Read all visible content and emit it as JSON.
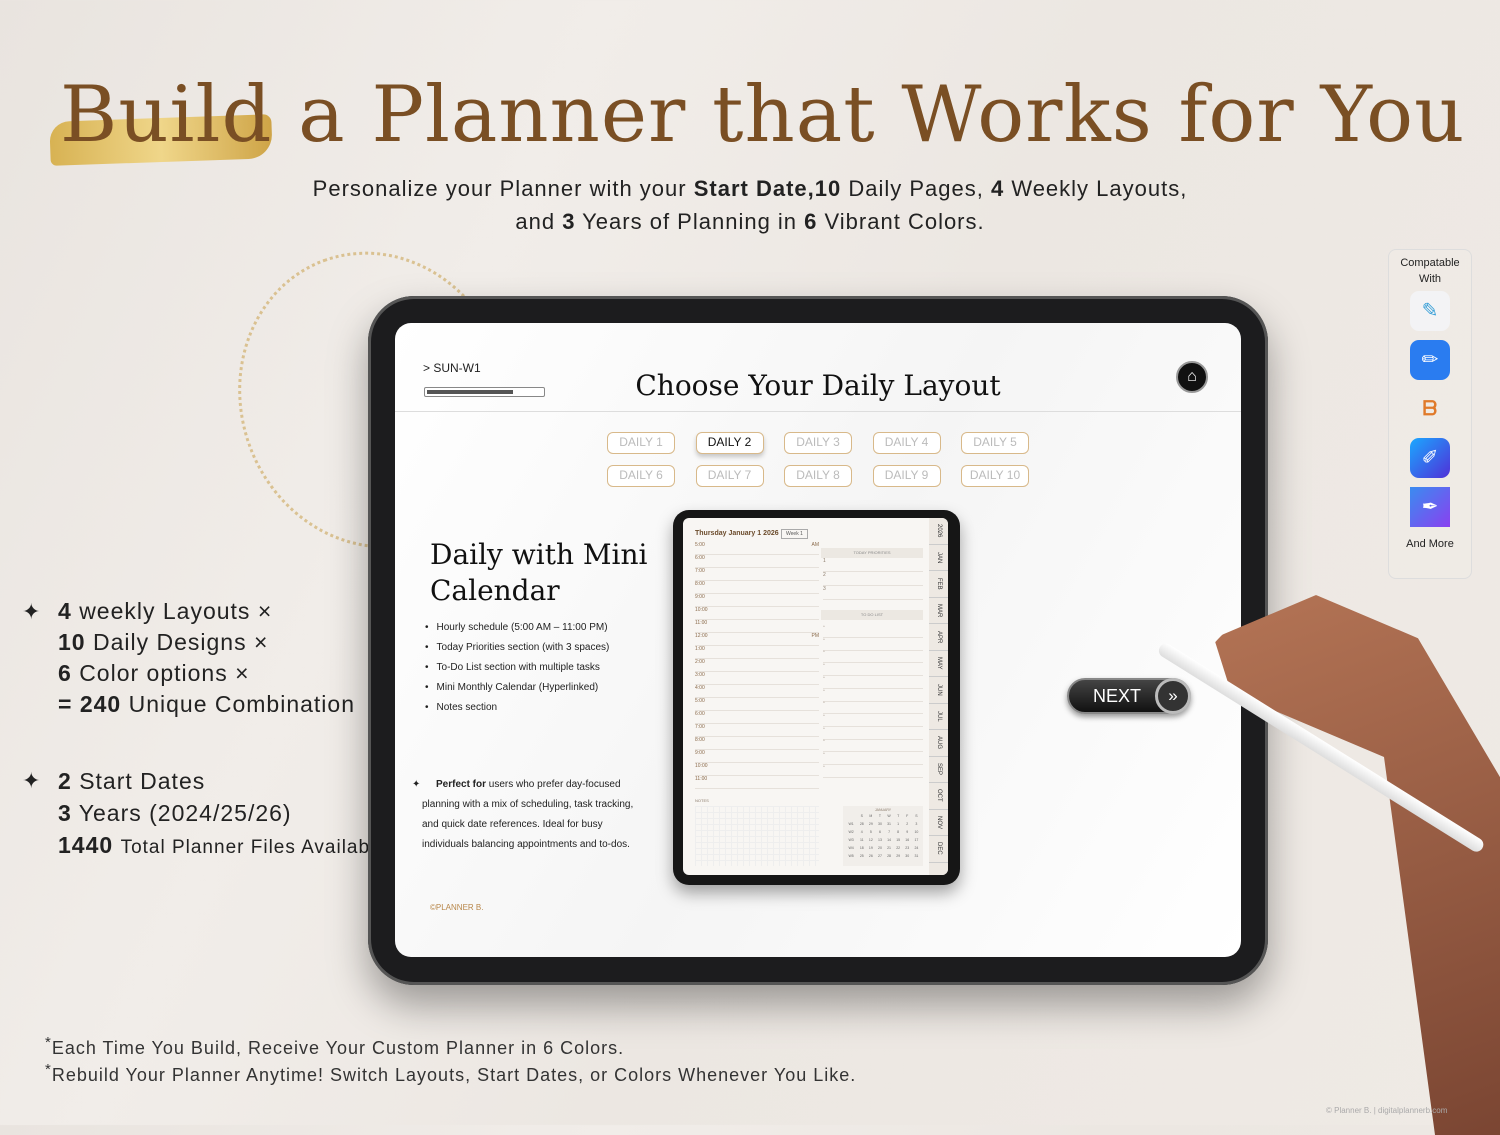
{
  "headline": {
    "title": "Build a Planner that Works for You",
    "sub_line1": [
      "Personalize your Planner with your ",
      "Start Date,10",
      " Daily Pages, ",
      "4",
      " Weekly Layouts,"
    ],
    "sub_line2": [
      "and ",
      "3",
      " Years of Planning in ",
      "6",
      " Vibrant Colors."
    ]
  },
  "features": {
    "combo": [
      {
        "num": "4",
        "text": "weekly Layouts",
        "op": "×"
      },
      {
        "num": "10",
        "text": "Daily Designs",
        "op": "×"
      },
      {
        "num": "6",
        "text": "Color options",
        "op": "×"
      },
      {
        "num": "= 240",
        "text": "Unique Combination",
        "op": ""
      }
    ],
    "files": [
      {
        "num": "2",
        "text": "Start Dates"
      },
      {
        "num": "3",
        "text": "Years (2024/25/26)"
      },
      {
        "num": "1440",
        "text": "Total Planner Files Available"
      }
    ]
  },
  "screen": {
    "breadcrumb": "> SUN-W1",
    "progress": 0.75,
    "title": "Choose Your Daily Layout",
    "layouts": [
      "DAILY 1",
      "DAILY 2",
      "DAILY 3",
      "DAILY 4",
      "DAILY 5",
      "DAILY 6",
      "DAILY 7",
      "DAILY 8",
      "DAILY 9",
      "DAILY 10"
    ],
    "selected_layout": "DAILY 2",
    "layout_name": "Daily with Mini Calendar",
    "bullets": [
      "Hourly schedule (5:00 AM – 11:00 PM)",
      "Today Priorities section (with 3 spaces)",
      "To-Do List section with multiple tasks",
      "Mini Monthly Calendar (Hyperlinked)",
      "Notes section"
    ],
    "perfect_bold": "Perfect for",
    "perfect_text": " users who prefer day-focused planning with a mix of scheduling, task tracking, and quick date references. Ideal for busy individuals balancing appointments and to-dos.",
    "copyright": "©PLANNER B.",
    "next": "NEXT"
  },
  "preview": {
    "date": "Thursday January 1 2026",
    "week": "Week 1",
    "hours": [
      "5:00",
      "6:00",
      "7:00",
      "8:00",
      "9:00",
      "10:00",
      "11:00",
      "12:00",
      "1:00",
      "2:00",
      "3:00",
      "4:00",
      "5:00",
      "6:00",
      "7:00",
      "8:00",
      "9:00",
      "10:00",
      "11:00"
    ],
    "am": "AM",
    "pm": "PM",
    "priorities_label": "TODAY PRIORITIES",
    "priorities": [
      "1",
      "2",
      "3"
    ],
    "todo_label": "TO DO LIST",
    "notes": "NOTES",
    "tabs": [
      "2026",
      "JAN",
      "FEB",
      "MAR",
      "APR",
      "MAY",
      "JUN",
      "JUL",
      "AUG",
      "SEP",
      "OCT",
      "NOV",
      "DEC"
    ],
    "calendar": {
      "month": "JANUARY",
      "days": [
        "S",
        "M",
        "T",
        "W",
        "T",
        "F",
        "S"
      ],
      "weeks": [
        [
          "W1",
          "28",
          "29",
          "30",
          "31",
          "1",
          "2",
          "3"
        ],
        [
          "W2",
          "4",
          "5",
          "6",
          "7",
          "8",
          "9",
          "10"
        ],
        [
          "W3",
          "11",
          "12",
          "13",
          "14",
          "15",
          "16",
          "17"
        ],
        [
          "W4",
          "18",
          "19",
          "20",
          "21",
          "22",
          "23",
          "24"
        ],
        [
          "W5",
          "25",
          "26",
          "27",
          "28",
          "29",
          "30",
          "31"
        ]
      ]
    }
  },
  "compat": {
    "label": "Compatable With",
    "apps": [
      "goodnotes-icon",
      "notability-icon",
      "xodo-icon",
      "noteshelf-icon",
      "penbook-icon"
    ],
    "more": "And More"
  },
  "footnotes": [
    "Each Time You Build, Receive Your Custom Planner in 6 Colors.",
    "Rebuild Your Planner Anytime! Switch Layouts, Start Dates, or Colors Whenever You Like."
  ],
  "credit": "© Planner B. | digitalplannerb.com",
  "colors": {
    "brand_brown": "#7a4f24",
    "gold": "#d4a93a",
    "button_border": "#d8b98a"
  }
}
